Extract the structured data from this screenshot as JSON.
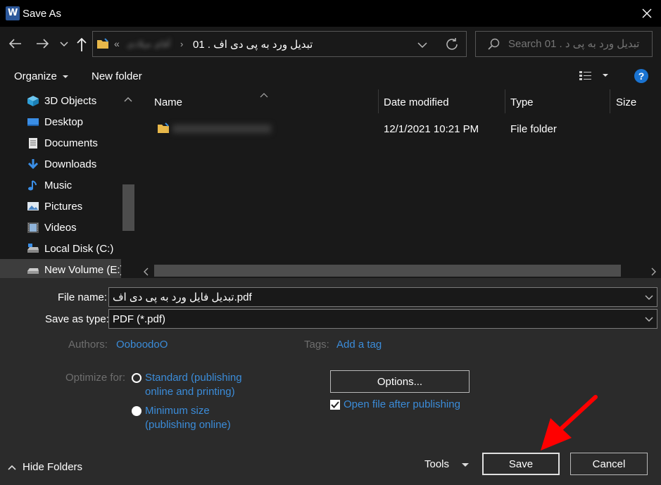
{
  "window": {
    "title": "Save As",
    "app_icon_letter": "W"
  },
  "address": {
    "path_root": "«",
    "path_blurred": "آقای میلادی",
    "path_current": "تبدیل ورد به پی دی اف . 01"
  },
  "search": {
    "placeholder": "Search تبدیل ورد به پی د . 01"
  },
  "toolbar": {
    "organize": "Organize",
    "new_folder": "New folder",
    "help": "?"
  },
  "nav": {
    "items": [
      {
        "label": "3D Objects",
        "icon": "cube-icon"
      },
      {
        "label": "Desktop",
        "icon": "desktop-icon"
      },
      {
        "label": "Documents",
        "icon": "documents-icon"
      },
      {
        "label": "Downloads",
        "icon": "download-arrow-icon"
      },
      {
        "label": "Music",
        "icon": "music-note-icon"
      },
      {
        "label": "Pictures",
        "icon": "pictures-icon"
      },
      {
        "label": "Videos",
        "icon": "film-icon"
      },
      {
        "label": "Local Disk (C:)",
        "icon": "local-disk-icon"
      },
      {
        "label": "New Volume (E:)",
        "icon": "drive-icon"
      }
    ]
  },
  "columns": {
    "name": "Name",
    "date": "Date modified",
    "type": "Type",
    "size": "Size"
  },
  "files": [
    {
      "name_blurred": true,
      "date": "12/1/2021 10:21 PM",
      "type": "File folder"
    }
  ],
  "form": {
    "file_name_label": "File name:",
    "file_name_value": "تبدیل فایل ورد به پی دی اف.pdf",
    "save_type_label": "Save as type:",
    "save_type_value": "PDF (*.pdf)",
    "authors_label": "Authors:",
    "authors_value": "OoboodoO",
    "tags_label": "Tags:",
    "tags_value": "Add a tag",
    "optimize_label": "Optimize for:",
    "opt_standard_1": "Standard (publishing",
    "opt_standard_2": "online and printing)",
    "opt_min_1": "Minimum size",
    "opt_min_2": "(publishing online)",
    "options_button": "Options...",
    "open_after_label": "Open file after publishing",
    "open_after_checked": true
  },
  "footer": {
    "hide_folders": "Hide Folders",
    "tools": "Tools",
    "save": "Save",
    "cancel": "Cancel"
  },
  "colors": {
    "accent_link": "#3b8cd9",
    "arrow": "#ff0000",
    "word_blue": "#2b579a",
    "help_blue": "#1a73d1"
  }
}
